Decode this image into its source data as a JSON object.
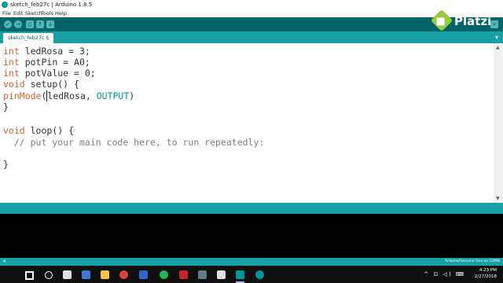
{
  "window": {
    "title": "sketch_feb27c | Arduino 1.8.5"
  },
  "menu": {
    "items": [
      "File",
      "Edit",
      "Sketch",
      "Tools",
      "Help"
    ]
  },
  "toolbar": {
    "buttons": [
      {
        "icon": "check-icon",
        "glyph": "✓"
      },
      {
        "icon": "arrow-right-icon",
        "glyph": "→"
      },
      {
        "icon": "new-file-icon",
        "glyph": "▯"
      },
      {
        "icon": "open-icon",
        "glyph": "↑"
      },
      {
        "icon": "save-icon",
        "glyph": "↓"
      }
    ],
    "serial_glyph": "⌕"
  },
  "tabs": {
    "active": "sketch_feb27c §",
    "menu_glyph": "▾"
  },
  "editor": {
    "line1": {
      "type": "int",
      "rest": " ledRosa = 3;"
    },
    "line2": {
      "type": "int",
      "rest": " potPin = A0;"
    },
    "line3": {
      "type": "int",
      "rest": " potValue = 0;"
    },
    "line4": {
      "type": "void",
      "rest": " setup() {"
    },
    "line5": {
      "fn": "pinMode",
      "open": "(",
      "arg1": "ledRosa, ",
      "const": "OUTPUT",
      "close": ")"
    },
    "line6": "}",
    "line7": {
      "type": "void",
      "rest": " loop() {"
    },
    "line8": "  // put your main code here, to run repeatedly:",
    "line9": "}"
  },
  "status": {
    "line": "4",
    "board": "Arduino/Genuino Uno on COM8"
  },
  "taskbar": {
    "time": "4:23 PM",
    "date": "2/27/2018",
    "tray": "^ ⊡ ◁) ⌨"
  },
  "brand": {
    "name": "Platzi"
  },
  "colors": {
    "toolbar": "#006468",
    "tabstrip": "#17a1a5",
    "keyword": "#cc6633",
    "constant": "#00979c",
    "comment": "#7f7f7f"
  }
}
